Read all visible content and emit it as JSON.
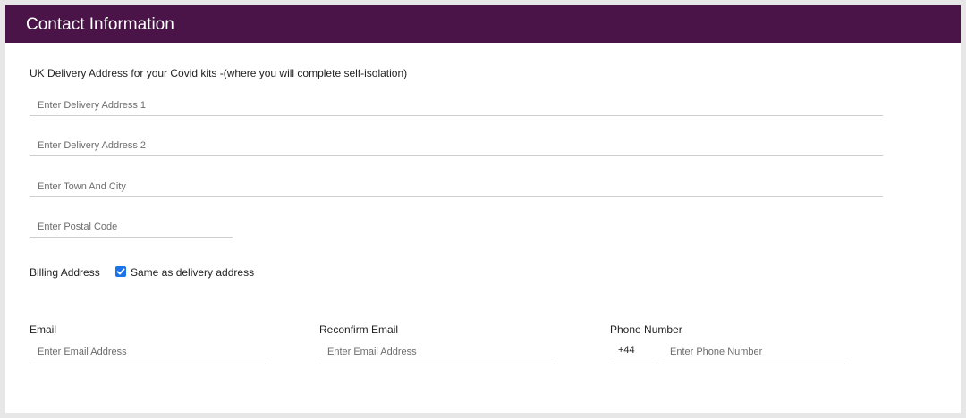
{
  "header": {
    "title": "Contact Information"
  },
  "delivery": {
    "intro": "UK Delivery Address for your Covid kits -(where you will complete self-isolation)",
    "address1_placeholder": "Enter Delivery Address 1",
    "address2_placeholder": "Enter Delivery Address 2",
    "town_placeholder": "Enter Town And City",
    "postal_placeholder": "Enter Postal Code"
  },
  "billing": {
    "label": "Billing Address",
    "same_as_delivery_label": "Same as delivery address",
    "same_as_delivery_checked": true
  },
  "contact": {
    "email_label": "Email",
    "email_placeholder": "Enter Email Address",
    "reconfirm_label": "Reconfirm Email",
    "reconfirm_placeholder": "Enter Email Address",
    "phone_label": "Phone Number",
    "phone_prefix": "+44",
    "phone_placeholder": "Enter Phone Number"
  },
  "colors": {
    "header_background": "#4a1449",
    "checkbox_accent": "#1b73e8"
  }
}
